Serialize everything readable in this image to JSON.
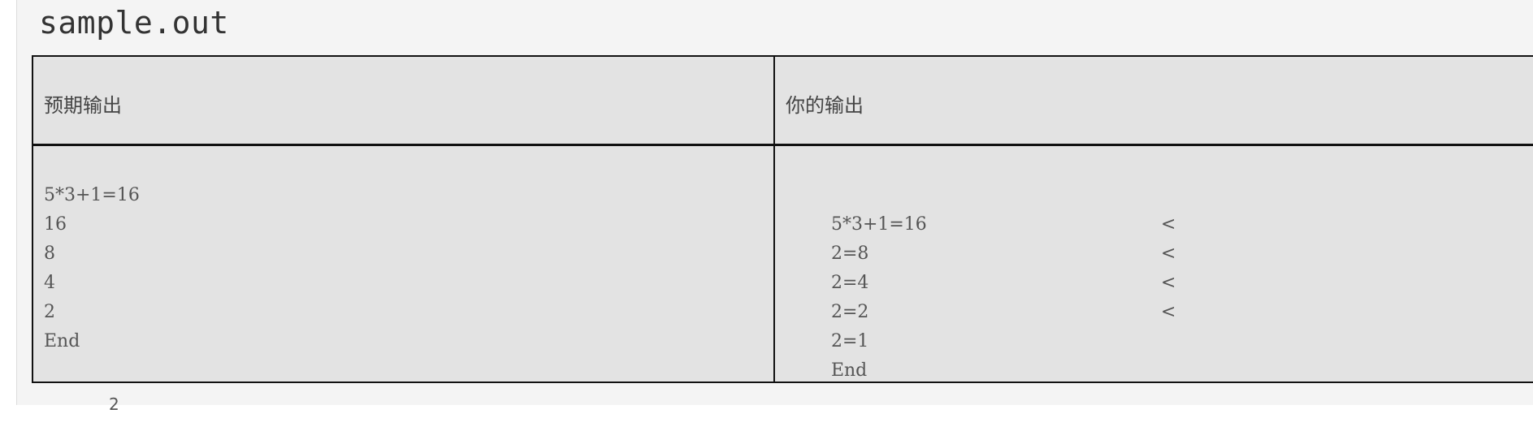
{
  "file": {
    "title": "sample.out"
  },
  "table": {
    "headers": {
      "expected": "预期输出",
      "actual": "你的输出"
    },
    "expected_lines": [
      "5*3+1=16",
      "16",
      "8",
      "4",
      "2",
      "End"
    ],
    "actual_lines": [
      {
        "text": "5*3+1=16",
        "marker": ""
      },
      {
        "text": "2=8",
        "marker": "<"
      },
      {
        "text": "2=4",
        "marker": "<"
      },
      {
        "text": "2=2",
        "marker": "<"
      },
      {
        "text": "2=1",
        "marker": "<"
      },
      {
        "text": "End",
        "marker": ""
      }
    ]
  },
  "footer": {
    "fragment": "2"
  }
}
